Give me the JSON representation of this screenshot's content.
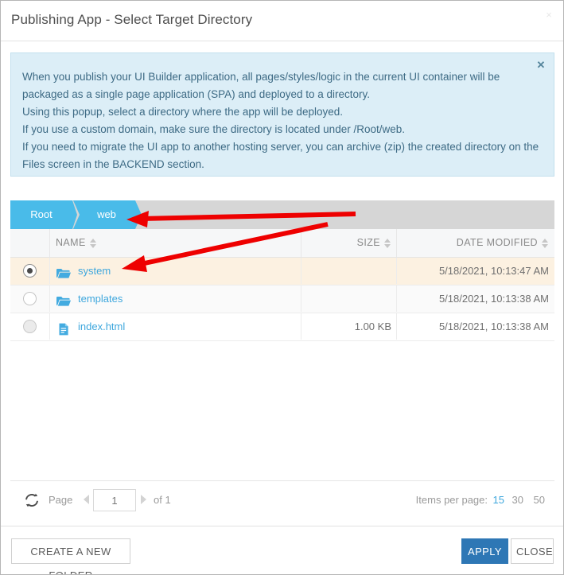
{
  "dialog": {
    "title": "Publishing App - Select Target Directory",
    "close_icon": "close-icon",
    "close_glyph": "×"
  },
  "info": {
    "close_glyph": "✕",
    "paragraphs": [
      "When you publish your UI Builder application, all pages/styles/logic in the current UI container will be packaged as a single page application (SPA) and deployed to a directory.",
      "Using this popup, select a directory where the app will be deployed.",
      "If you use a custom domain, make sure the directory is located under /Root/web.",
      "If you need to migrate the UI app to another hosting server, you can archive (zip) the created directory on the Files screen in the BACKEND section."
    ]
  },
  "breadcrumb": {
    "items": [
      {
        "label": "Root"
      },
      {
        "label": "web"
      }
    ]
  },
  "table": {
    "columns": [
      {
        "key": "select",
        "label": ""
      },
      {
        "key": "name",
        "label": "NAME"
      },
      {
        "key": "size",
        "label": "SIZE"
      },
      {
        "key": "date",
        "label": "DATE MODIFIED"
      }
    ],
    "rows": [
      {
        "icon": "folder-icon",
        "name": "system",
        "size": "",
        "date": "5/18/2021, 10:13:47 AM",
        "selected": true
      },
      {
        "icon": "folder-icon",
        "name": "templates",
        "size": "",
        "date": "5/18/2021, 10:13:38 AM",
        "selected": false
      },
      {
        "icon": "file-icon",
        "name": "index.html",
        "size": "1.00 KB",
        "date": "5/18/2021, 10:13:38 AM",
        "selected": false
      }
    ]
  },
  "pagination": {
    "refresh_icon": "refresh-icon",
    "page_label": "Page",
    "page_value": "1",
    "of_label": "of 1",
    "items_per_page_label": "Items per page:",
    "options": [
      "15",
      "30",
      "50"
    ],
    "selected_option": "15"
  },
  "footer": {
    "new_folder_label": "CREATE A NEW FOLDER",
    "apply_label": "APPLY",
    "close_label": "CLOSE"
  },
  "colors": {
    "accent_blue": "#3ea7dd",
    "breadcrumb_blue": "#49bbe9",
    "info_bg": "#dceef7",
    "info_text": "#3d6a84",
    "selected_row": "#fcf1e1",
    "apply_button": "#2e77b5",
    "annotation_red": "#ee0000"
  },
  "annotations": [
    {
      "name": "arrow-to-breadcrumb"
    },
    {
      "name": "arrow-to-system-folder"
    }
  ]
}
